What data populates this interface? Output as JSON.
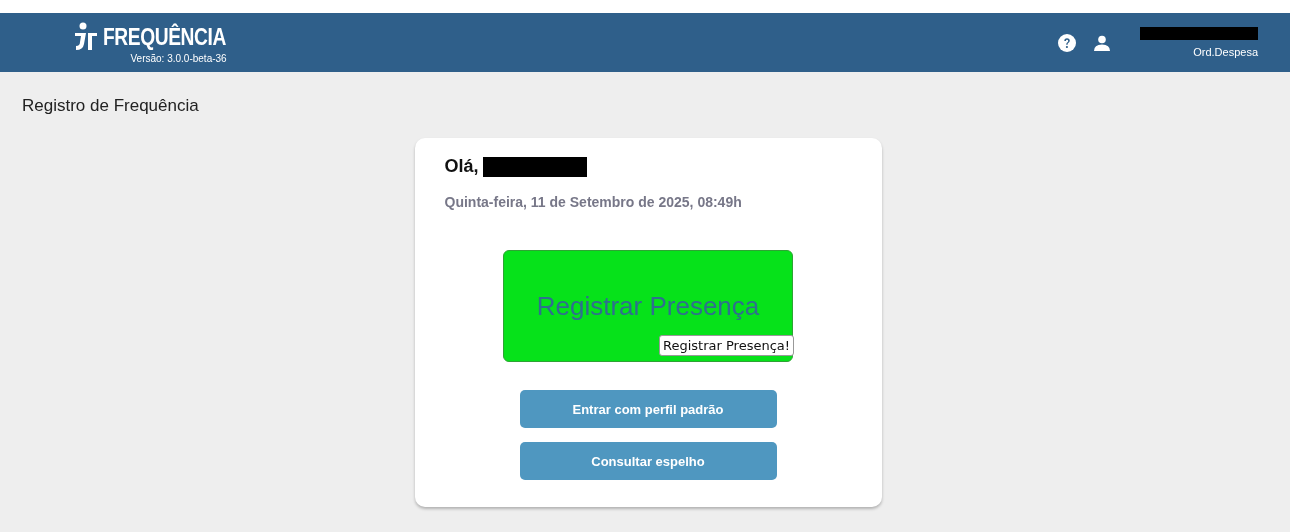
{
  "header": {
    "app_name": "FREQUÊNCIA",
    "version": "Versão: 3.0.0-beta-36",
    "user_role": "Ord.Despesa"
  },
  "page_title": "Registro de Frequência",
  "card": {
    "greeting": "Olá,",
    "date": "Quinta-feira, 11 de Setembro de 2025, 08:49h",
    "register_button": {
      "label": "Registrar Presença",
      "tooltip": "Registrar Presença!"
    },
    "buttons": [
      "Entrar com perfil padrão",
      "Consultar espelho"
    ]
  }
}
